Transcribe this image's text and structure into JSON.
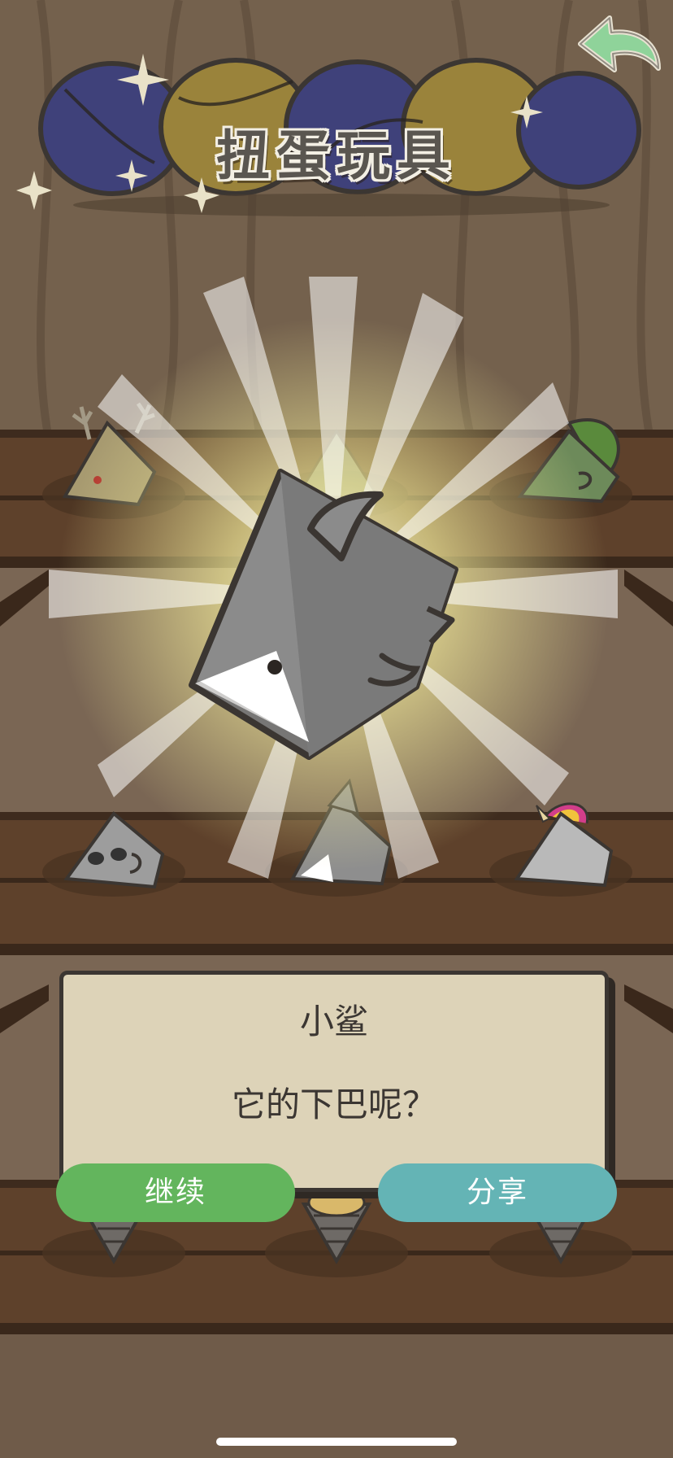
{
  "header": {
    "title": "扭蛋玩具",
    "back_icon": "back-arrow-icon"
  },
  "result": {
    "name": "小鲨",
    "description": "它的下巴呢？"
  },
  "buttons": {
    "continue_label": "继续",
    "share_label": "分享"
  },
  "shelf_toys": [
    "deer-toy",
    "ghost-toy",
    "peacock-toy",
    "panda-toy",
    "shark-toy",
    "unicorn-toy",
    "cone-toy-1",
    "cone-toy-2",
    "cone-toy-3"
  ],
  "colors": {
    "continue_button": "#63b55d",
    "share_button": "#64b4b5",
    "dialog_bg": "#ddd3b8",
    "back_arrow": "#8fd39a",
    "capsule_blue": "#3f417a",
    "capsule_gold": "#9a833b"
  }
}
